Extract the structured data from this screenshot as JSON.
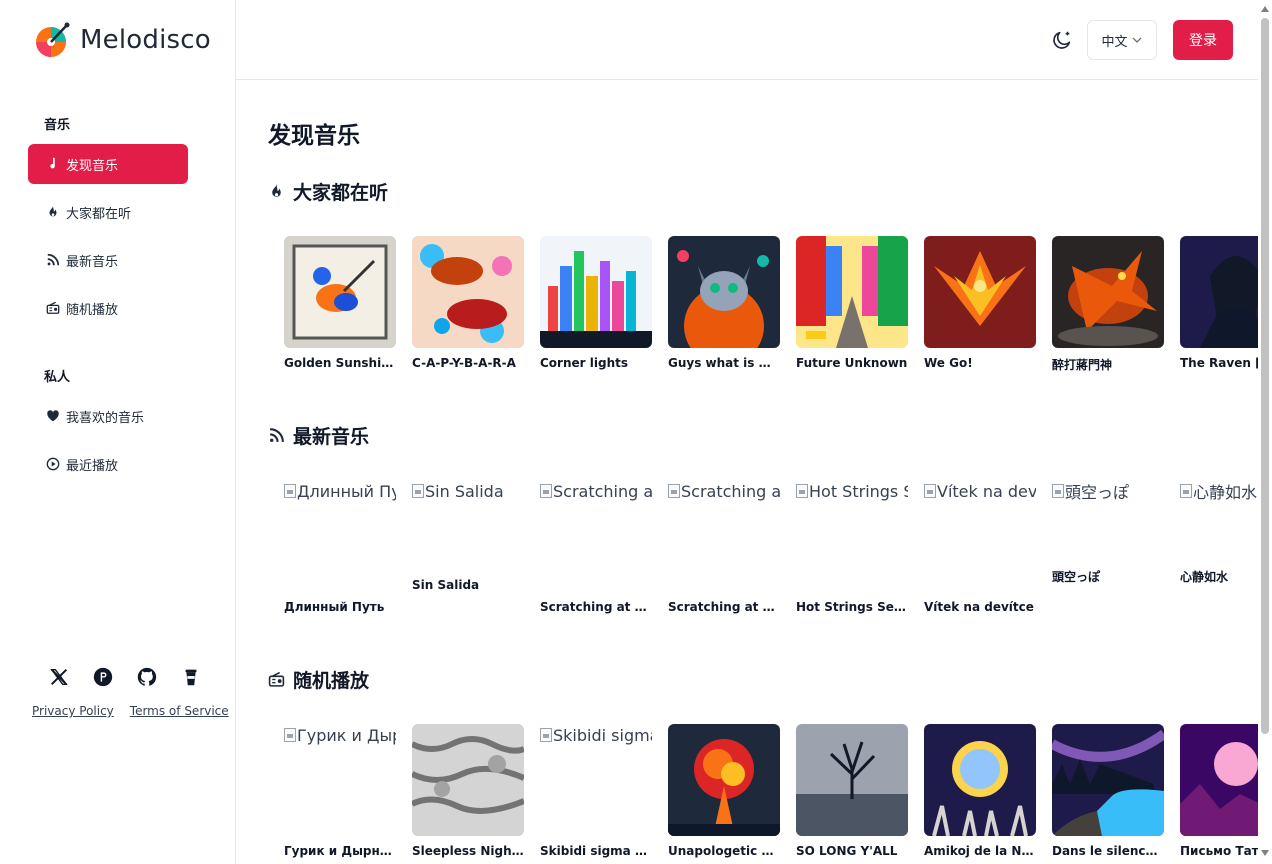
{
  "brand": {
    "name": "Melodisco"
  },
  "sidebar": {
    "section_music": "音乐",
    "section_private": "私人",
    "music_items": [
      {
        "label": "发现音乐",
        "icon": "music-note-icon",
        "active": true
      },
      {
        "label": "大家都在听",
        "icon": "flame-icon",
        "active": false
      },
      {
        "label": "最新音乐",
        "icon": "rss-icon",
        "active": false
      },
      {
        "label": "随机播放",
        "icon": "radio-icon",
        "active": false
      }
    ],
    "private_items": [
      {
        "label": "我喜欢的音乐",
        "icon": "heart-icon"
      },
      {
        "label": "最近播放",
        "icon": "play-circle-icon"
      }
    ],
    "socials": [
      "x-icon",
      "producthunt-icon",
      "github-icon",
      "coffee-icon"
    ],
    "links": {
      "privacy": "Privacy Policy",
      "terms": "Terms of Service"
    }
  },
  "header": {
    "lang": "中文",
    "login": "登录"
  },
  "page_title": "发现音乐",
  "sections": {
    "trending": {
      "title": "大家都在听",
      "items": [
        "Golden Sunshine...",
        "C-A-P-Y-B-A-R-A",
        "Corner lights",
        "Guys what is wr...",
        "Future Unknown",
        "We Go!",
        "醉打蔣門神",
        "The Raven [S"
      ]
    },
    "latest": {
      "title": "最新音乐",
      "items": [
        {
          "alt": "Длинный Пу",
          "title": "Длинный Путь"
        },
        {
          "alt": "Sin Salida",
          "title": "Sin Salida"
        },
        {
          "alt": "Scratching at",
          "title": "Scratching at th..."
        },
        {
          "alt": "Scratching at",
          "title": "Scratching at th..."
        },
        {
          "alt": "Hot Strings S",
          "title": "Hot Strings Sere..."
        },
        {
          "alt": "Vítek na dev",
          "title": "Vítek na devítce"
        },
        {
          "alt": "頭空っぽ",
          "title": "頭空っぽ"
        },
        {
          "alt": "心静如水",
          "title": "心静如水"
        }
      ]
    },
    "random": {
      "title": "随机播放",
      "items": [
        {
          "alt": "Гурик и Дыр",
          "title": "Гурик и Дырник"
        },
        {
          "alt": "",
          "title": "Sleepless Nights"
        },
        {
          "alt": "Skibidi sigma",
          "title": "Skibidi sigma ohio"
        },
        {
          "alt": "",
          "title": "Unapologetic Lo..."
        },
        {
          "alt": "",
          "title": "SO LONG Y'ALL"
        },
        {
          "alt": "",
          "title": "Amikoj de la No..."
        },
        {
          "alt": "",
          "title": "Dans le silence d..."
        },
        {
          "alt": "",
          "title": "Письмо Тать"
        }
      ]
    }
  }
}
